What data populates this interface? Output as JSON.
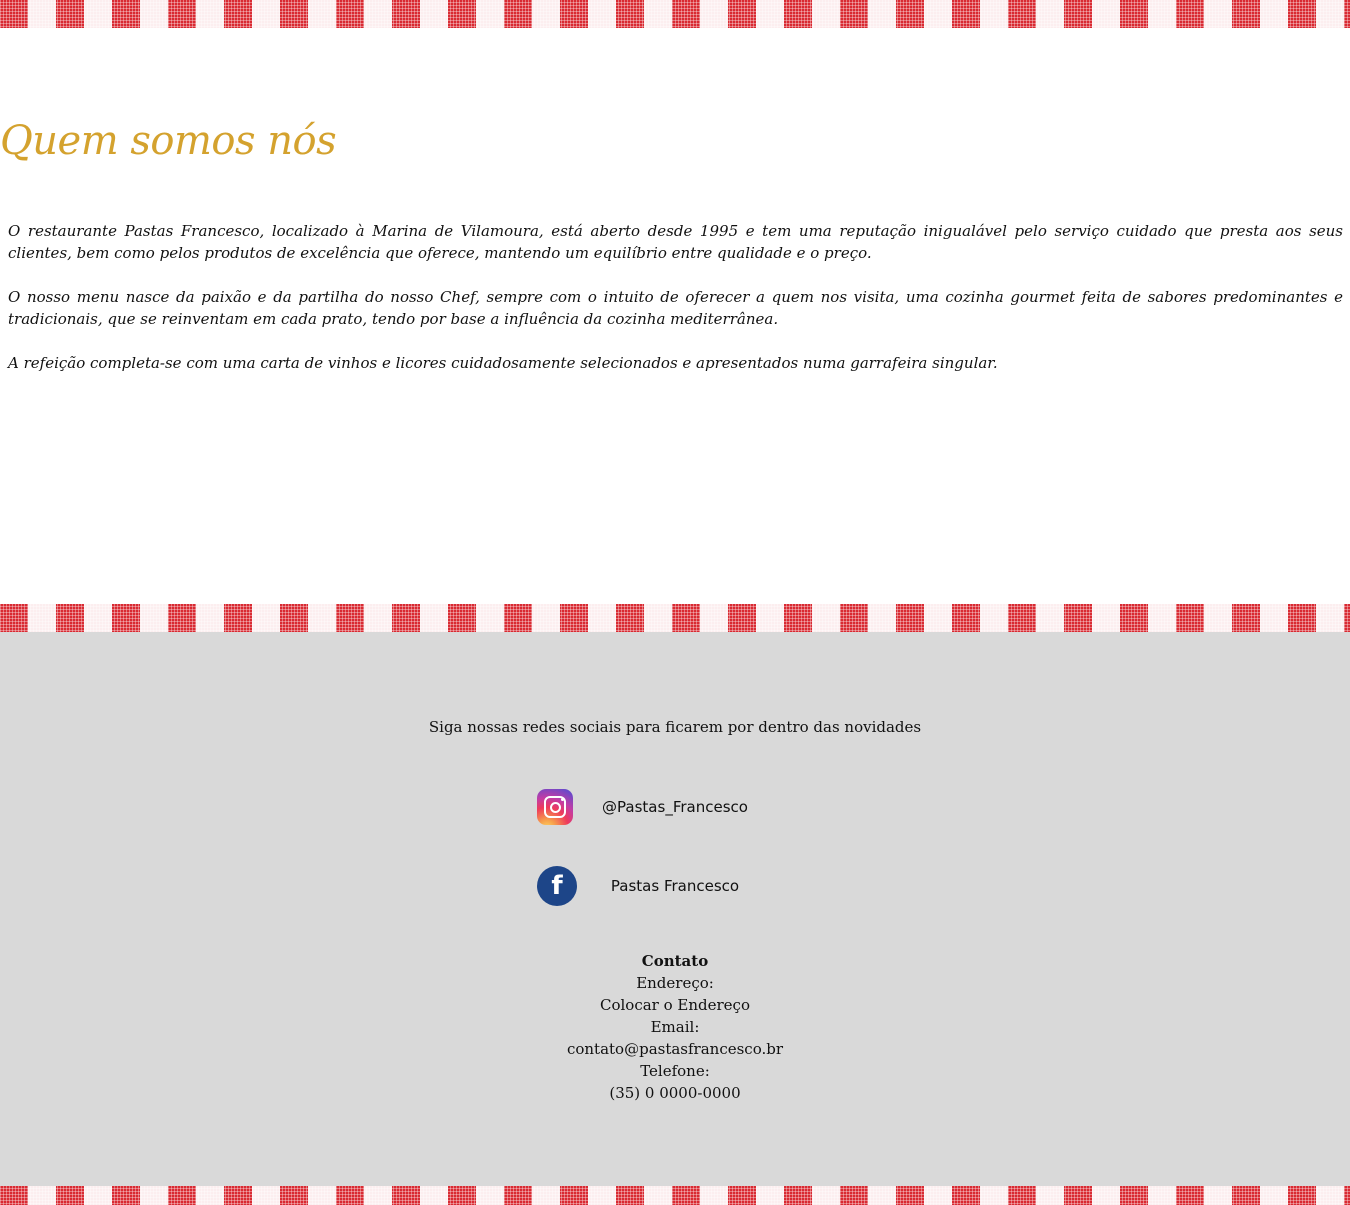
{
  "about": {
    "title": "Quem somos nós",
    "paragraphs": [
      "O restaurante Pastas Francesco, localizado à Marina de Vilamoura, está aberto desde 1995 e tem uma reputação inigualável pelo serviço cuidado que presta aos seus clientes, bem como pelos produtos de excelência que oferece, mantendo um equilíbrio entre qualidade e o preço.",
      "O nosso menu nasce da paixão e da partilha do nosso Chef, sempre com o intuito de oferecer a quem nos visita, uma cozinha gourmet feita de sabores predominantes e tradicionais, que se reinventam em cada prato, tendo por base a influência da cozinha mediterrânea.",
      "A refeição completa-se com uma carta de vinhos e licores cuidadosamente selecionados e apresentados numa garrafeira singular."
    ]
  },
  "footer": {
    "follow_text": "Siga nossas redes sociais para ficarem por dentro das novidades",
    "instagram": {
      "icon": "instagram-icon",
      "label": "@Pastas_Francesco"
    },
    "facebook": {
      "icon": "facebook-icon",
      "glyph": "f",
      "label": "Pastas Francesco"
    },
    "contact": {
      "title": "Contato",
      "address_label": "Endereço:",
      "address_value": "Colocar o Endereço",
      "email_label": "Email:",
      "email_value": "contato@pastasfrancesco.br",
      "phone_label": "Telefone:",
      "phone_value": "(35) 0 0000-0000"
    }
  },
  "colors": {
    "title_gold": "#d4a22e",
    "checker_red": "#d92a32",
    "footer_bg": "#d9d9d9",
    "facebook_blue": "#1d4588"
  }
}
